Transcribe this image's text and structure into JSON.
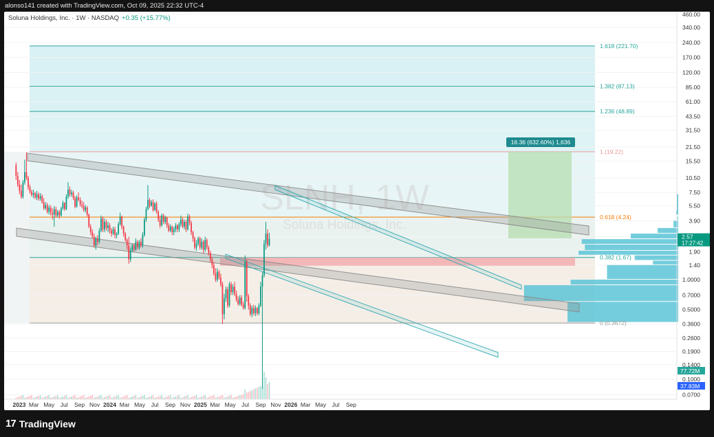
{
  "header": {
    "text": "alonso141 created with TradingView.com, Oct 09, 2025 22:32 UTC-4"
  },
  "symbol_line": {
    "name": "Soluna Holdings, Inc. · 1W · NASDAQ",
    "change": "+0.35 (+15.77%)"
  },
  "watermark": {
    "ticker": "SLNH, 1W",
    "company": "Soluna Holdings, Inc."
  },
  "footer": {
    "brand": "TradingView",
    "logo": "17"
  },
  "colors": {
    "up": "#089981",
    "down": "#f23645",
    "fib_618": "#f57c00",
    "fib_1": "#ef9a9a",
    "fib_teal": "#26a69a",
    "channel": "#2ca8b0"
  },
  "chart_data": {
    "type": "candlestick",
    "title": "SLNH, 1W",
    "y_scale": "log",
    "y_ticks": [
      "460.00",
      "340.00",
      "240.00",
      "170.00",
      "120.00",
      "85.00",
      "61.00",
      "43.50",
      "31.50",
      "21.50",
      "15.50",
      "10.50",
      "7.50",
      "5.50",
      "3.90",
      "2.70",
      "1.90",
      "1.40",
      "1.0000",
      "0.7000",
      "0.5000",
      "0.3600",
      "0.2600",
      "0.1900",
      "0.1400",
      "0.1000",
      "0.0700"
    ],
    "x_ticks": [
      "2023",
      "Mar",
      "May",
      "Jul",
      "Sep",
      "Nov",
      "2024",
      "Mar",
      "May",
      "Jul",
      "Sep",
      "Nov",
      "2025",
      "Mar",
      "May",
      "Jul",
      "Sep",
      "Nov",
      "2026",
      "Mar",
      "May",
      "Jul",
      "Sep"
    ],
    "bold_x_ticks": [
      "2023",
      "2024",
      "2025",
      "2026"
    ],
    "fib_levels": [
      {
        "label": "1.618 (221.70)",
        "value": 221.7
      },
      {
        "label": "1.382 (87.13)",
        "value": 87.13
      },
      {
        "label": "1.236 (48.89)",
        "value": 48.89
      },
      {
        "label": "1 (19.22)",
        "value": 19.22
      },
      {
        "label": "0.618 (4.24)",
        "value": 4.24
      },
      {
        "label": "0.382 (1.67)",
        "value": 1.67
      },
      {
        "label": "0 (0.3672)",
        "value": 0.3672
      }
    ],
    "measure_label": "16.36 (632.60%) 1,636",
    "last_price": {
      "price": "2.57",
      "countdown": "17:27:42"
    },
    "volume_labels": [
      "77.72M",
      "37.83M"
    ],
    "price_series": [
      {
        "date": "2022-12-19",
        "o": 14,
        "h": 15,
        "l": 10,
        "c": 11
      },
      {
        "date": "2022-12-26",
        "o": 11,
        "h": 12,
        "l": 8.5,
        "c": 9
      },
      {
        "date": "2023-01-02",
        "o": 9,
        "h": 10,
        "l": 7.2,
        "c": 7.8
      },
      {
        "date": "2023-01-09",
        "o": 7.8,
        "h": 9,
        "l": 6.5,
        "c": 6.8
      },
      {
        "date": "2023-01-16",
        "o": 6.8,
        "h": 10,
        "l": 6.5,
        "c": 9.5
      },
      {
        "date": "2023-01-23",
        "o": 9.5,
        "h": 16,
        "l": 9,
        "c": 12
      },
      {
        "date": "2023-01-30",
        "o": 12,
        "h": 19,
        "l": 10,
        "c": 10.5
      },
      {
        "date": "2023-02-06",
        "o": 10.5,
        "h": 11,
        "l": 8,
        "c": 8.5
      },
      {
        "date": "2023-02-13",
        "o": 8.5,
        "h": 9,
        "l": 7.3,
        "c": 7.6
      },
      {
        "date": "2023-02-20",
        "o": 7.6,
        "h": 8,
        "l": 6.8,
        "c": 7.1
      },
      {
        "date": "2023-02-27",
        "o": 7.1,
        "h": 8,
        "l": 6.6,
        "c": 7.4
      },
      {
        "date": "2023-03-06",
        "o": 7.4,
        "h": 7.6,
        "l": 6.4,
        "c": 6.7
      },
      {
        "date": "2023-03-13",
        "o": 6.7,
        "h": 7.8,
        "l": 6.3,
        "c": 7.2
      },
      {
        "date": "2023-03-20",
        "o": 7.2,
        "h": 7.5,
        "l": 6.2,
        "c": 6.5
      },
      {
        "date": "2023-03-27",
        "o": 6.5,
        "h": 7.4,
        "l": 6.2,
        "c": 6.9
      },
      {
        "date": "2023-04-03",
        "o": 6.9,
        "h": 7.2,
        "l": 5.8,
        "c": 6.0
      },
      {
        "date": "2023-04-10",
        "o": 6.0,
        "h": 6.6,
        "l": 5.0,
        "c": 5.2
      },
      {
        "date": "2023-04-17",
        "o": 5.2,
        "h": 6.0,
        "l": 5.0,
        "c": 5.6
      },
      {
        "date": "2023-04-24",
        "o": 5.6,
        "h": 5.9,
        "l": 4.6,
        "c": 4.8
      },
      {
        "date": "2023-05-01",
        "o": 4.8,
        "h": 5.6,
        "l": 4.5,
        "c": 5.3
      },
      {
        "date": "2023-05-08",
        "o": 5.3,
        "h": 5.6,
        "l": 4.4,
        "c": 4.7
      },
      {
        "date": "2023-05-15",
        "o": 4.7,
        "h": 5.2,
        "l": 4.0,
        "c": 4.5
      },
      {
        "date": "2023-05-22",
        "o": 4.5,
        "h": 5.5,
        "l": 3.4,
        "c": 5.1
      },
      {
        "date": "2023-05-29",
        "o": 5.1,
        "h": 5.4,
        "l": 4.2,
        "c": 4.4
      },
      {
        "date": "2023-06-05",
        "o": 4.4,
        "h": 5.0,
        "l": 4.2,
        "c": 4.8
      },
      {
        "date": "2023-06-12",
        "o": 4.8,
        "h": 5.0,
        "l": 4.1,
        "c": 4.4
      },
      {
        "date": "2023-06-19",
        "o": 4.4,
        "h": 5.4,
        "l": 4.3,
        "c": 5.2
      },
      {
        "date": "2023-06-26",
        "o": 5.2,
        "h": 6.2,
        "l": 5.0,
        "c": 5.9
      },
      {
        "date": "2023-07-03",
        "o": 5.9,
        "h": 6.0,
        "l": 4.9,
        "c": 5.1
      },
      {
        "date": "2023-07-10",
        "o": 5.1,
        "h": 7.2,
        "l": 5.0,
        "c": 6.8
      },
      {
        "date": "2023-07-17",
        "o": 6.8,
        "h": 9.5,
        "l": 6.5,
        "c": 8.0
      },
      {
        "date": "2023-07-24",
        "o": 8.0,
        "h": 8.6,
        "l": 6.8,
        "c": 7.2
      },
      {
        "date": "2023-07-31",
        "o": 7.2,
        "h": 8.0,
        "l": 6.8,
        "c": 7.5
      },
      {
        "date": "2023-08-07",
        "o": 7.5,
        "h": 7.8,
        "l": 6.3,
        "c": 6.6
      },
      {
        "date": "2023-08-14",
        "o": 6.6,
        "h": 6.9,
        "l": 5.2,
        "c": 5.4
      },
      {
        "date": "2023-08-21",
        "o": 5.4,
        "h": 7.0,
        "l": 5.3,
        "c": 6.7
      },
      {
        "date": "2023-08-28",
        "o": 6.7,
        "h": 7.5,
        "l": 6.1,
        "c": 6.3
      },
      {
        "date": "2023-09-04",
        "o": 6.3,
        "h": 6.7,
        "l": 5.4,
        "c": 5.7
      },
      {
        "date": "2023-09-11",
        "o": 5.7,
        "h": 6.2,
        "l": 5.2,
        "c": 5.5
      },
      {
        "date": "2023-09-18",
        "o": 5.5,
        "h": 6.0,
        "l": 4.8,
        "c": 5.0
      },
      {
        "date": "2023-09-25",
        "o": 5.0,
        "h": 5.6,
        "l": 4.7,
        "c": 5.3
      },
      {
        "date": "2023-10-02",
        "o": 5.3,
        "h": 5.5,
        "l": 4.3,
        "c": 4.5
      },
      {
        "date": "2023-10-09",
        "o": 4.5,
        "h": 4.6,
        "l": 3.3,
        "c": 3.4
      },
      {
        "date": "2023-10-16",
        "o": 3.4,
        "h": 3.6,
        "l": 2.8,
        "c": 3.0
      },
      {
        "date": "2023-10-23",
        "o": 3.0,
        "h": 3.2,
        "l": 2.6,
        "c": 2.7
      },
      {
        "date": "2023-10-30",
        "o": 2.7,
        "h": 2.9,
        "l": 2.1,
        "c": 2.2
      },
      {
        "date": "2023-11-06",
        "o": 2.2,
        "h": 2.7,
        "l": 2.0,
        "c": 2.6
      },
      {
        "date": "2023-11-13",
        "o": 2.6,
        "h": 2.8,
        "l": 2.2,
        "c": 2.4
      },
      {
        "date": "2023-11-20",
        "o": 2.4,
        "h": 3.3,
        "l": 2.3,
        "c": 3.1
      },
      {
        "date": "2023-11-27",
        "o": 3.1,
        "h": 4.4,
        "l": 3.0,
        "c": 4.1
      },
      {
        "date": "2023-12-04",
        "o": 4.1,
        "h": 4.3,
        "l": 3.0,
        "c": 3.2
      },
      {
        "date": "2023-12-11",
        "o": 3.2,
        "h": 4.1,
        "l": 3.0,
        "c": 3.8
      },
      {
        "date": "2023-12-18",
        "o": 3.8,
        "h": 4.0,
        "l": 3.1,
        "c": 3.3
      },
      {
        "date": "2023-12-25",
        "o": 3.3,
        "h": 3.8,
        "l": 3.0,
        "c": 3.5
      },
      {
        "date": "2024-01-01",
        "o": 3.5,
        "h": 3.7,
        "l": 2.9,
        "c": 3.1
      },
      {
        "date": "2024-01-08",
        "o": 3.1,
        "h": 3.3,
        "l": 2.7,
        "c": 2.9
      },
      {
        "date": "2024-01-15",
        "o": 2.9,
        "h": 3.4,
        "l": 2.8,
        "c": 3.2
      },
      {
        "date": "2024-01-22",
        "o": 3.2,
        "h": 3.4,
        "l": 2.6,
        "c": 2.8
      },
      {
        "date": "2024-01-29",
        "o": 2.8,
        "h": 3.0,
        "l": 2.6,
        "c": 2.9
      },
      {
        "date": "2024-02-05",
        "o": 2.9,
        "h": 3.8,
        "l": 2.8,
        "c": 3.6
      },
      {
        "date": "2024-02-12",
        "o": 3.6,
        "h": 4.7,
        "l": 3.5,
        "c": 4.3
      },
      {
        "date": "2024-02-19",
        "o": 4.3,
        "h": 4.4,
        "l": 3.2,
        "c": 3.4
      },
      {
        "date": "2024-02-26",
        "o": 3.4,
        "h": 3.5,
        "l": 2.7,
        "c": 2.9
      },
      {
        "date": "2024-03-04",
        "o": 2.9,
        "h": 3.0,
        "l": 2.4,
        "c": 2.5
      },
      {
        "date": "2024-03-11",
        "o": 2.5,
        "h": 2.6,
        "l": 2.0,
        "c": 2.2
      },
      {
        "date": "2024-03-18",
        "o": 2.2,
        "h": 2.7,
        "l": 1.45,
        "c": 1.6
      },
      {
        "date": "2024-03-25",
        "o": 1.6,
        "h": 2.1,
        "l": 1.5,
        "c": 1.95
      },
      {
        "date": "2024-04-01",
        "o": 1.95,
        "h": 2.3,
        "l": 1.9,
        "c": 2.2
      },
      {
        "date": "2024-04-08",
        "o": 2.2,
        "h": 2.3,
        "l": 1.9,
        "c": 2.0
      },
      {
        "date": "2024-04-15",
        "o": 2.0,
        "h": 2.6,
        "l": 1.95,
        "c": 2.4
      },
      {
        "date": "2024-04-22",
        "o": 2.4,
        "h": 2.5,
        "l": 2.0,
        "c": 2.1
      },
      {
        "date": "2024-04-29",
        "o": 2.1,
        "h": 2.5,
        "l": 2.0,
        "c": 2.4
      },
      {
        "date": "2024-05-06",
        "o": 2.4,
        "h": 2.6,
        "l": 2.1,
        "c": 2.2
      },
      {
        "date": "2024-05-13",
        "o": 2.2,
        "h": 3.0,
        "l": 2.1,
        "c": 2.8
      },
      {
        "date": "2024-05-20",
        "o": 2.8,
        "h": 4.2,
        "l": 2.7,
        "c": 4.0
      },
      {
        "date": "2024-05-27",
        "o": 4.0,
        "h": 5.4,
        "l": 3.8,
        "c": 5.1
      },
      {
        "date": "2024-06-03",
        "o": 5.1,
        "h": 8.9,
        "l": 5.0,
        "c": 6.3
      },
      {
        "date": "2024-06-10",
        "o": 6.3,
        "h": 6.6,
        "l": 5.2,
        "c": 5.5
      },
      {
        "date": "2024-06-17",
        "o": 5.5,
        "h": 6.3,
        "l": 5.4,
        "c": 6.0
      },
      {
        "date": "2024-06-24",
        "o": 6.0,
        "h": 6.4,
        "l": 4.8,
        "c": 5.0
      },
      {
        "date": "2024-07-01",
        "o": 5.0,
        "h": 6.0,
        "l": 4.9,
        "c": 5.8
      },
      {
        "date": "2024-07-08",
        "o": 5.8,
        "h": 6.1,
        "l": 4.6,
        "c": 4.8
      },
      {
        "date": "2024-07-15",
        "o": 4.8,
        "h": 5.0,
        "l": 3.8,
        "c": 4.0
      },
      {
        "date": "2024-07-22",
        "o": 4.0,
        "h": 4.4,
        "l": 3.3,
        "c": 3.5
      },
      {
        "date": "2024-07-29",
        "o": 3.5,
        "h": 4.6,
        "l": 3.4,
        "c": 4.4
      },
      {
        "date": "2024-08-05",
        "o": 4.4,
        "h": 4.6,
        "l": 3.6,
        "c": 3.8
      },
      {
        "date": "2024-08-12",
        "o": 3.8,
        "h": 4.4,
        "l": 3.6,
        "c": 4.2
      },
      {
        "date": "2024-08-19",
        "o": 4.2,
        "h": 4.3,
        "l": 3.3,
        "c": 3.5
      },
      {
        "date": "2024-08-26",
        "o": 3.5,
        "h": 3.7,
        "l": 3.0,
        "c": 3.1
      },
      {
        "date": "2024-09-02",
        "o": 3.1,
        "h": 3.6,
        "l": 3.0,
        "c": 3.4
      },
      {
        "date": "2024-09-09",
        "o": 3.4,
        "h": 3.5,
        "l": 2.8,
        "c": 3.0
      },
      {
        "date": "2024-09-16",
        "o": 3.0,
        "h": 3.4,
        "l": 2.8,
        "c": 3.2
      },
      {
        "date": "2024-09-23",
        "o": 3.2,
        "h": 3.7,
        "l": 3.0,
        "c": 3.5
      },
      {
        "date": "2024-09-30",
        "o": 3.5,
        "h": 3.6,
        "l": 3.0,
        "c": 3.2
      },
      {
        "date": "2024-10-07",
        "o": 3.2,
        "h": 3.8,
        "l": 3.0,
        "c": 3.6
      },
      {
        "date": "2024-10-14",
        "o": 3.6,
        "h": 4.4,
        "l": 3.4,
        "c": 4.0
      },
      {
        "date": "2024-10-21",
        "o": 4.0,
        "h": 4.2,
        "l": 3.3,
        "c": 3.4
      },
      {
        "date": "2024-10-28",
        "o": 3.4,
        "h": 4.0,
        "l": 3.2,
        "c": 3.8
      },
      {
        "date": "2024-11-04",
        "o": 3.8,
        "h": 4.0,
        "l": 3.0,
        "c": 3.2
      },
      {
        "date": "2024-11-11",
        "o": 3.2,
        "h": 4.6,
        "l": 3.1,
        "c": 4.3
      },
      {
        "date": "2024-11-18",
        "o": 4.3,
        "h": 4.5,
        "l": 3.5,
        "c": 3.7
      },
      {
        "date": "2024-11-25",
        "o": 3.7,
        "h": 3.9,
        "l": 2.8,
        "c": 3.0
      },
      {
        "date": "2024-12-02",
        "o": 3.0,
        "h": 3.1,
        "l": 2.4,
        "c": 2.6
      },
      {
        "date": "2024-12-09",
        "o": 2.6,
        "h": 2.7,
        "l": 2.0,
        "c": 2.1
      },
      {
        "date": "2024-12-16",
        "o": 2.1,
        "h": 2.5,
        "l": 1.95,
        "c": 2.3
      },
      {
        "date": "2024-12-23",
        "o": 2.3,
        "h": 2.7,
        "l": 2.2,
        "c": 2.6
      },
      {
        "date": "2024-12-30",
        "o": 2.6,
        "h": 2.7,
        "l": 2.0,
        "c": 2.1
      },
      {
        "date": "2025-01-06",
        "o": 2.1,
        "h": 2.6,
        "l": 2.0,
        "c": 2.4
      },
      {
        "date": "2025-01-13",
        "o": 2.4,
        "h": 2.5,
        "l": 1.85,
        "c": 2.0
      },
      {
        "date": "2025-01-20",
        "o": 2.0,
        "h": 2.7,
        "l": 1.9,
        "c": 2.5
      },
      {
        "date": "2025-01-27",
        "o": 2.5,
        "h": 2.6,
        "l": 2.0,
        "c": 2.1
      },
      {
        "date": "2025-02-03",
        "o": 2.1,
        "h": 2.2,
        "l": 1.75,
        "c": 1.85
      },
      {
        "date": "2025-02-10",
        "o": 1.85,
        "h": 1.95,
        "l": 1.5,
        "c": 1.6
      },
      {
        "date": "2025-02-17",
        "o": 1.6,
        "h": 1.7,
        "l": 1.3,
        "c": 1.4
      },
      {
        "date": "2025-02-24",
        "o": 1.4,
        "h": 1.5,
        "l": 1.1,
        "c": 1.15
      },
      {
        "date": "2025-03-03",
        "o": 1.15,
        "h": 1.3,
        "l": 0.95,
        "c": 1.0
      },
      {
        "date": "2025-03-10",
        "o": 1.0,
        "h": 1.3,
        "l": 0.95,
        "c": 1.2
      },
      {
        "date": "2025-03-17",
        "o": 1.2,
        "h": 1.25,
        "l": 1.0,
        "c": 1.05
      },
      {
        "date": "2025-03-24",
        "o": 1.05,
        "h": 1.15,
        "l": 0.85,
        "c": 0.9
      },
      {
        "date": "2025-03-31",
        "o": 0.9,
        "h": 0.95,
        "l": 0.36,
        "c": 0.45
      },
      {
        "date": "2025-04-07",
        "o": 0.45,
        "h": 0.72,
        "l": 0.4,
        "c": 0.65
      },
      {
        "date": "2025-04-14",
        "o": 0.65,
        "h": 0.85,
        "l": 0.6,
        "c": 0.8
      },
      {
        "date": "2025-04-21",
        "o": 0.8,
        "h": 0.85,
        "l": 0.52,
        "c": 0.55
      },
      {
        "date": "2025-04-28",
        "o": 0.55,
        "h": 0.95,
        "l": 0.53,
        "c": 0.9
      },
      {
        "date": "2025-05-05",
        "o": 0.9,
        "h": 0.95,
        "l": 0.7,
        "c": 0.75
      },
      {
        "date": "2025-05-12",
        "o": 0.75,
        "h": 0.9,
        "l": 0.7,
        "c": 0.85
      },
      {
        "date": "2025-05-19",
        "o": 0.85,
        "h": 0.95,
        "l": 0.68,
        "c": 0.72
      },
      {
        "date": "2025-05-26",
        "o": 0.72,
        "h": 0.78,
        "l": 0.6,
        "c": 0.63
      },
      {
        "date": "2025-06-02",
        "o": 0.63,
        "h": 0.68,
        "l": 0.55,
        "c": 0.57
      },
      {
        "date": "2025-06-09",
        "o": 0.57,
        "h": 0.7,
        "l": 0.55,
        "c": 0.66
      },
      {
        "date": "2025-06-16",
        "o": 0.66,
        "h": 0.7,
        "l": 0.54,
        "c": 0.56
      },
      {
        "date": "2025-06-23",
        "o": 0.56,
        "h": 0.6,
        "l": 0.5,
        "c": 0.52
      },
      {
        "date": "2025-06-30",
        "o": 0.52,
        "h": 1.75,
        "l": 0.5,
        "c": 1.5
      },
      {
        "date": "2025-07-07",
        "o": 1.5,
        "h": 1.6,
        "l": 0.6,
        "c": 0.68
      },
      {
        "date": "2025-07-14",
        "o": 0.68,
        "h": 0.72,
        "l": 0.5,
        "c": 0.55
      },
      {
        "date": "2025-07-21",
        "o": 0.55,
        "h": 0.58,
        "l": 0.43,
        "c": 0.45
      },
      {
        "date": "2025-07-28",
        "o": 0.45,
        "h": 0.55,
        "l": 0.42,
        "c": 0.52
      },
      {
        "date": "2025-08-04",
        "o": 0.52,
        "h": 0.56,
        "l": 0.44,
        "c": 0.46
      },
      {
        "date": "2025-08-11",
        "o": 0.46,
        "h": 0.55,
        "l": 0.43,
        "c": 0.52
      },
      {
        "date": "2025-08-18",
        "o": 0.52,
        "h": 0.53,
        "l": 0.44,
        "c": 0.46
      },
      {
        "date": "2025-08-25",
        "o": 0.46,
        "h": 0.58,
        "l": 0.44,
        "c": 0.55
      },
      {
        "date": "2025-09-01",
        "o": 0.55,
        "h": 0.95,
        "l": 0.53,
        "c": 0.85
      },
      {
        "date": "2025-09-08",
        "o": 0.85,
        "h": 1.2,
        "l": 0.08,
        "c": 1.1
      },
      {
        "date": "2025-09-15",
        "o": 1.1,
        "h": 2.5,
        "l": 1.05,
        "c": 2.3
      },
      {
        "date": "2025-09-22",
        "o": 2.3,
        "h": 3.8,
        "l": 2.0,
        "c": 2.9
      },
      {
        "date": "2025-09-29",
        "o": 2.9,
        "h": 3.2,
        "l": 2.1,
        "c": 2.22
      },
      {
        "date": "2025-10-06",
        "o": 2.22,
        "h": 2.95,
        "l": 2.15,
        "c": 2.57
      }
    ]
  }
}
